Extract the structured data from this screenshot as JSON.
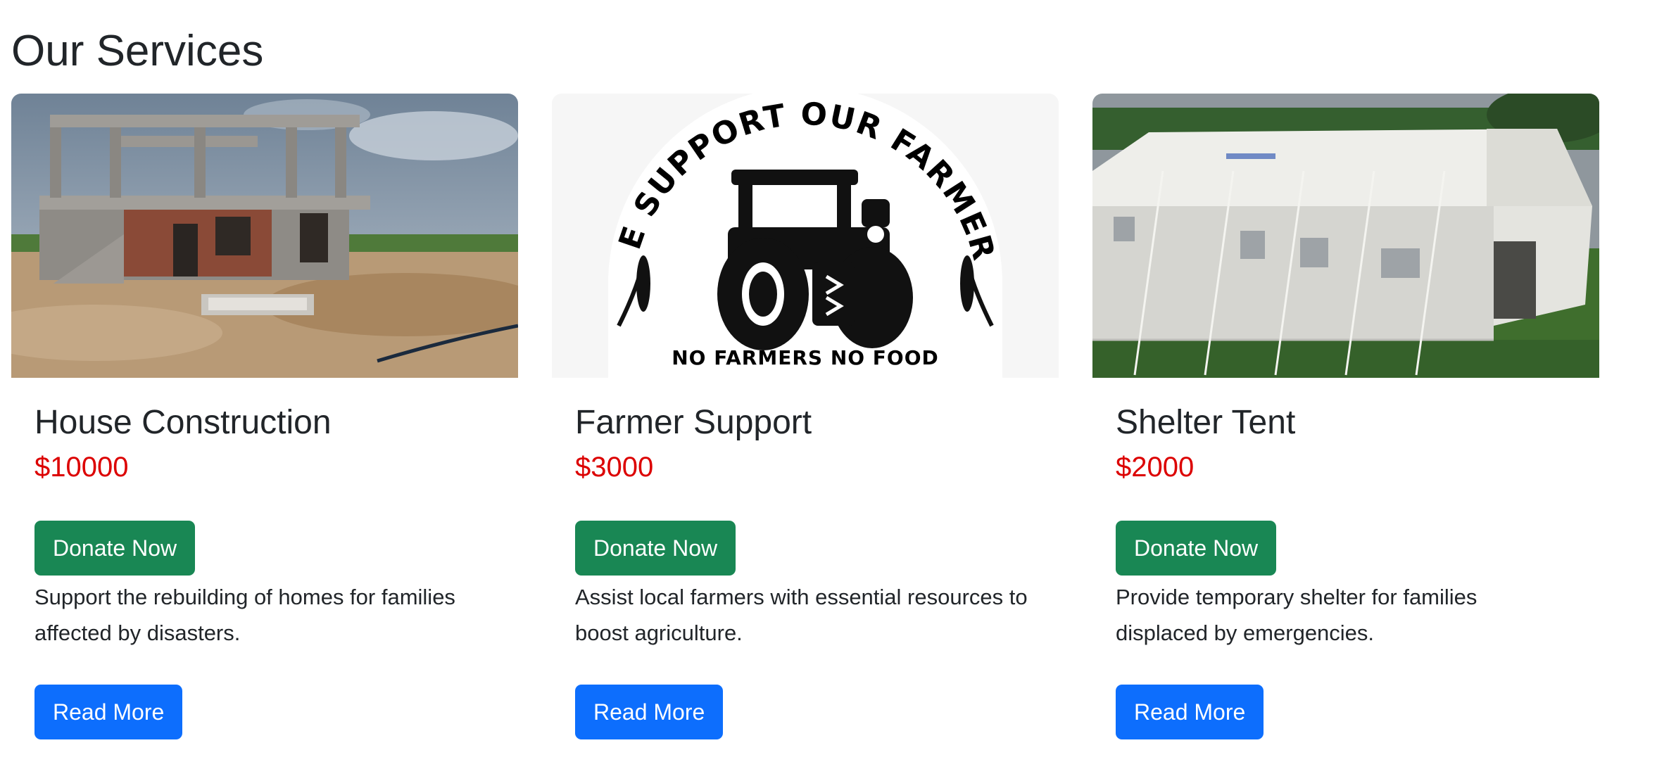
{
  "page_title": "Our Services",
  "colors": {
    "price": "#dc0000",
    "donate_button": "#198754",
    "read_more_button": "#0d6efd",
    "text": "#212529"
  },
  "services": [
    {
      "image": "house-construction-image",
      "title": "House Construction",
      "price": "$10000",
      "donate_label": "Donate Now",
      "description": "Support the rebuilding of homes for families affected by disasters.",
      "read_more_label": "Read More"
    },
    {
      "image": "farmer-support-logo-image",
      "image_text": {
        "arc": "WE SUPPORT OUR FARMERS",
        "bottom": "NO FARMERS NO FOOD"
      },
      "title": "Farmer Support",
      "price": "$3000",
      "donate_label": "Donate Now",
      "description": "Assist local farmers with essential resources to boost agriculture.",
      "read_more_label": "Read More"
    },
    {
      "image": "shelter-tent-image",
      "title": "Shelter Tent",
      "price": "$2000",
      "donate_label": "Donate Now",
      "description": "Provide temporary shelter for families displaced by emergencies.",
      "read_more_label": "Read More"
    }
  ]
}
